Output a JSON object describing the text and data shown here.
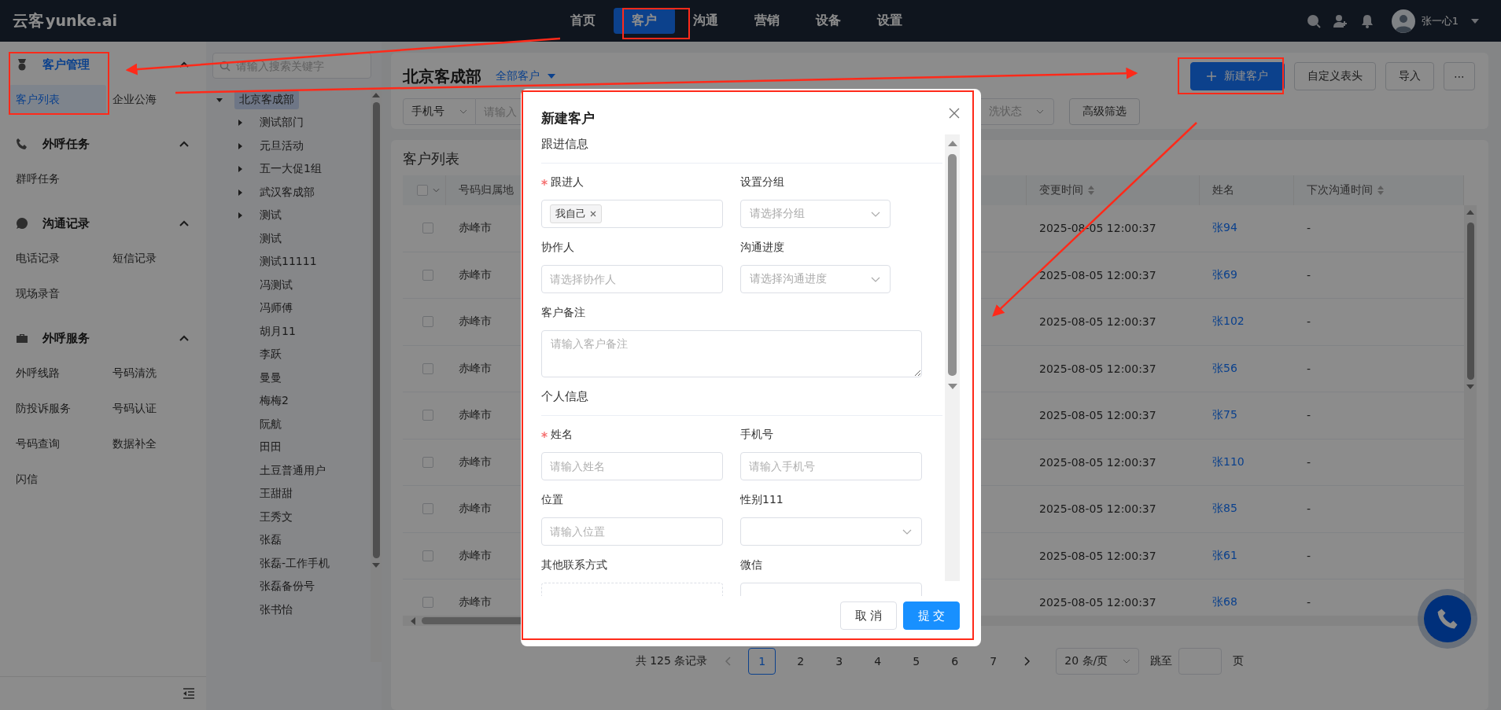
{
  "top_bar": {
    "logo_cn": "云客",
    "logo_en": "yunke.ai",
    "nav": [
      {
        "label": "首页",
        "selected": false
      },
      {
        "label": "客户",
        "selected": true
      },
      {
        "label": "沟通",
        "selected": false
      },
      {
        "label": "营销",
        "selected": false
      },
      {
        "label": "设备",
        "selected": false
      },
      {
        "label": "设置",
        "selected": false
      }
    ],
    "user": {
      "name": "张一心1"
    }
  },
  "sidebar": {
    "sections": [
      {
        "title": "客户管理",
        "expanded": true,
        "items": [
          {
            "label": "客户列表",
            "selected": true
          },
          {
            "label": "企业公海",
            "selected": false
          }
        ]
      },
      {
        "title": "外呼任务",
        "expanded": true,
        "items": [
          {
            "label": "群呼任务",
            "selected": false
          }
        ]
      },
      {
        "title": "沟通记录",
        "expanded": true,
        "items": [
          {
            "label": "电话记录",
            "selected": false
          },
          {
            "label": "短信记录",
            "selected": false
          },
          {
            "label": "现场录音",
            "selected": false
          }
        ]
      },
      {
        "title": "外呼服务",
        "expanded": true,
        "items": [
          {
            "label": "外呼线路",
            "selected": false
          },
          {
            "label": "号码清洗",
            "selected": false
          },
          {
            "label": "防投诉服务",
            "selected": false
          },
          {
            "label": "号码认证",
            "selected": false
          },
          {
            "label": "号码查询",
            "selected": false
          },
          {
            "label": "数据补全",
            "selected": false
          },
          {
            "label": "闪信",
            "selected": false
          }
        ]
      }
    ]
  },
  "tree": {
    "search": {
      "placeholder": "请输入搜索关键字"
    },
    "root": {
      "label": "北京客成部",
      "expanded": true,
      "selected": true,
      "children": [
        {
          "label": "测试部门",
          "expanded": false
        },
        {
          "label": "元旦活动",
          "expanded": false
        },
        {
          "label": "五一大促1组",
          "expanded": false
        },
        {
          "label": "武汉客成部",
          "expanded": false
        },
        {
          "label": "测试",
          "expanded": false
        },
        {
          "label": "测试"
        },
        {
          "label": "测试11111"
        },
        {
          "label": "冯测试"
        },
        {
          "label": "冯师傅"
        },
        {
          "label": "胡月11"
        },
        {
          "label": "李跃"
        },
        {
          "label": "曼曼"
        },
        {
          "label": "梅梅2"
        },
        {
          "label": "阮航"
        },
        {
          "label": "田田"
        },
        {
          "label": "土豆普通用户"
        },
        {
          "label": "王甜甜"
        },
        {
          "label": "王秀文"
        },
        {
          "label": "张磊"
        },
        {
          "label": "张磊-工作手机"
        },
        {
          "label": "张磊备份号"
        },
        {
          "label": "张书怡"
        }
      ]
    }
  },
  "main": {
    "title": "北京客成部",
    "scope": "全部客户",
    "buttons": [
      {
        "label": "新建客户",
        "kind": "primary"
      },
      {
        "label": "自定义表头",
        "kind": "default"
      },
      {
        "label": "导入",
        "kind": "default"
      },
      {
        "label": "⋯",
        "kind": "more"
      }
    ],
    "filters": [
      {
        "kind": "select",
        "value": "手机号"
      },
      {
        "kind": "input",
        "placeholder": "请输入"
      },
      {
        "kind": "select",
        "placeholder": "洗状态"
      },
      {
        "kind": "button",
        "label": "高级筛选"
      }
    ]
  },
  "table": {
    "title": "客户列表",
    "select_all": {
      "checked": false
    },
    "columns": [
      {
        "label": "号码归属地",
        "sortable": false
      },
      {
        "label": "变更时间",
        "sortable": true
      },
      {
        "label": "姓名",
        "sortable": false
      },
      {
        "label": "下次沟通时间",
        "sortable": true
      }
    ],
    "rows": [
      {
        "checked": false,
        "cells": [
          "赤峰市",
          "2025-08-05 12:00:37",
          "张94",
          "-"
        ]
      },
      {
        "checked": false,
        "cells": [
          "赤峰市",
          "2025-08-05 12:00:37",
          "张69",
          "-"
        ]
      },
      {
        "checked": false,
        "cells": [
          "赤峰市",
          "2025-08-05 12:00:37",
          "张102",
          "-"
        ]
      },
      {
        "checked": false,
        "cells": [
          "赤峰市",
          "2025-08-05 12:00:37",
          "张56",
          "-"
        ]
      },
      {
        "checked": false,
        "cells": [
          "赤峰市",
          "2025-08-05 12:00:37",
          "张75",
          "-"
        ]
      },
      {
        "checked": false,
        "cells": [
          "赤峰市",
          "2025-08-05 12:00:37",
          "张110",
          "-"
        ]
      },
      {
        "checked": false,
        "cells": [
          "赤峰市",
          "2025-08-05 12:00:37",
          "张85",
          "-"
        ]
      },
      {
        "checked": false,
        "cells": [
          "赤峰市",
          "2025-08-05 12:00:37",
          "张61",
          "-"
        ]
      },
      {
        "checked": false,
        "cells": [
          "赤峰市",
          "2025-08-05 12:00:37",
          "张68",
          "-"
        ]
      }
    ]
  },
  "pagination": {
    "total": "共 125 条记录",
    "pages": [
      {
        "label": "1",
        "selected": true
      },
      {
        "label": "2",
        "selected": false
      },
      {
        "label": "3",
        "selected": false
      },
      {
        "label": "4",
        "selected": false
      },
      {
        "label": "5",
        "selected": false
      },
      {
        "label": "6",
        "selected": false
      },
      {
        "label": "7",
        "selected": false
      }
    ],
    "page_size": "20 条/页",
    "jump_label": "跳至",
    "page_suffix": "页"
  },
  "modal": {
    "title": "新建客户",
    "sections": [
      {
        "title": "跟进信息",
        "fields": [
          {
            "label": "跟进人",
            "required": true,
            "kind": "tags",
            "tags": [
              "我自己"
            ]
          },
          {
            "label": "设置分组",
            "required": false,
            "kind": "select",
            "placeholder": "请选择分组"
          },
          {
            "label": "协作人",
            "required": false,
            "kind": "input",
            "placeholder": "请选择协作人"
          },
          {
            "label": "沟通进度",
            "required": false,
            "kind": "select",
            "placeholder": "请选择沟通进度"
          },
          {
            "label": "客户备注",
            "required": false,
            "kind": "textarea",
            "placeholder": "请输入客户备注"
          }
        ]
      },
      {
        "title": "个人信息",
        "fields": [
          {
            "label": "姓名",
            "required": true,
            "kind": "input",
            "placeholder": "请输入姓名"
          },
          {
            "label": "手机号",
            "required": false,
            "kind": "input",
            "placeholder": "请输入手机号"
          },
          {
            "label": "位置",
            "required": false,
            "kind": "input",
            "placeholder": "请输入位置"
          },
          {
            "label": "性别111",
            "required": false,
            "kind": "select"
          },
          {
            "label": "其他联系方式",
            "required": false,
            "kind": "dashed"
          },
          {
            "label": "微信",
            "required": false,
            "kind": "input"
          }
        ]
      }
    ],
    "buttons": [
      {
        "label": "取 消",
        "kind": "default"
      },
      {
        "label": "提 交",
        "kind": "primary"
      }
    ]
  }
}
